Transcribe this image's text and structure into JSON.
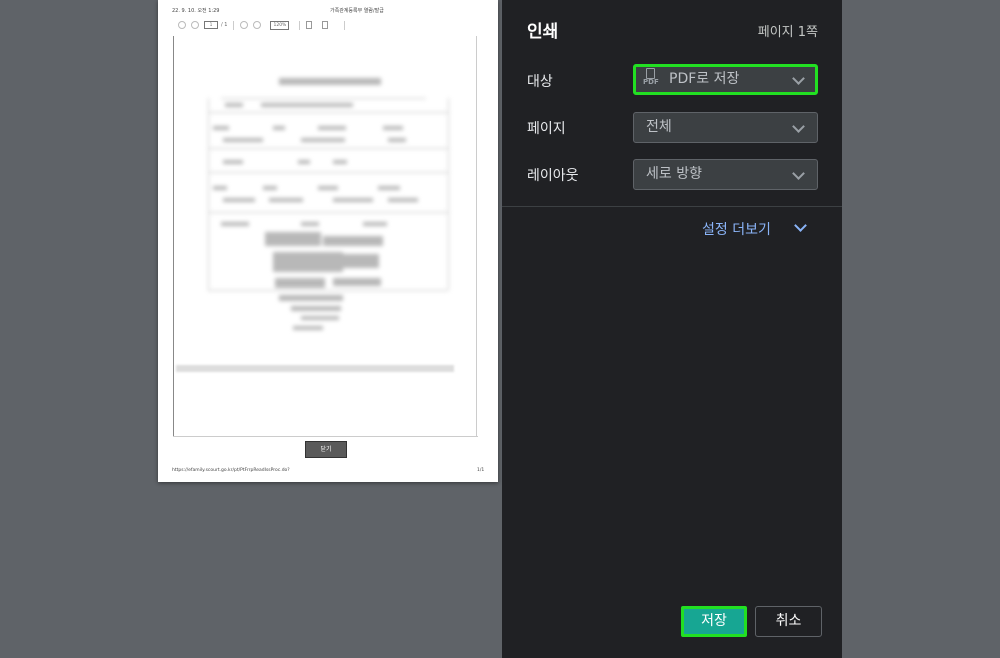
{
  "preview": {
    "header_date": "22. 9. 10. 오전 1:29",
    "header_title": "가족관계등록부 열람/발급",
    "toolbar": {
      "page_current": "1",
      "page_total": "/ 1",
      "zoom": "120%"
    },
    "close_button": "닫기",
    "footer_url": "https://efamily.scourt.go.kr/pt/PtFrrpReadIssProc.do?",
    "footer_page": "1/1"
  },
  "panel": {
    "title": "인쇄",
    "page_count": "페이지 1쪽",
    "destination": {
      "label": "대상",
      "value": "PDF로 저장",
      "icon_text": "PDF",
      "icon": "pdf-file-icon"
    },
    "pages": {
      "label": "페이지",
      "value": "전체"
    },
    "layout": {
      "label": "레이아웃",
      "value": "세로 방향"
    },
    "more_settings": "설정 더보기",
    "save_button": "저장",
    "cancel_button": "취소"
  },
  "colors": {
    "panel_bg": "#202124",
    "backdrop": "#5f6368",
    "accent_teal": "#17a693",
    "highlight_green": "#22e022",
    "link_blue": "#8ab4f8"
  }
}
